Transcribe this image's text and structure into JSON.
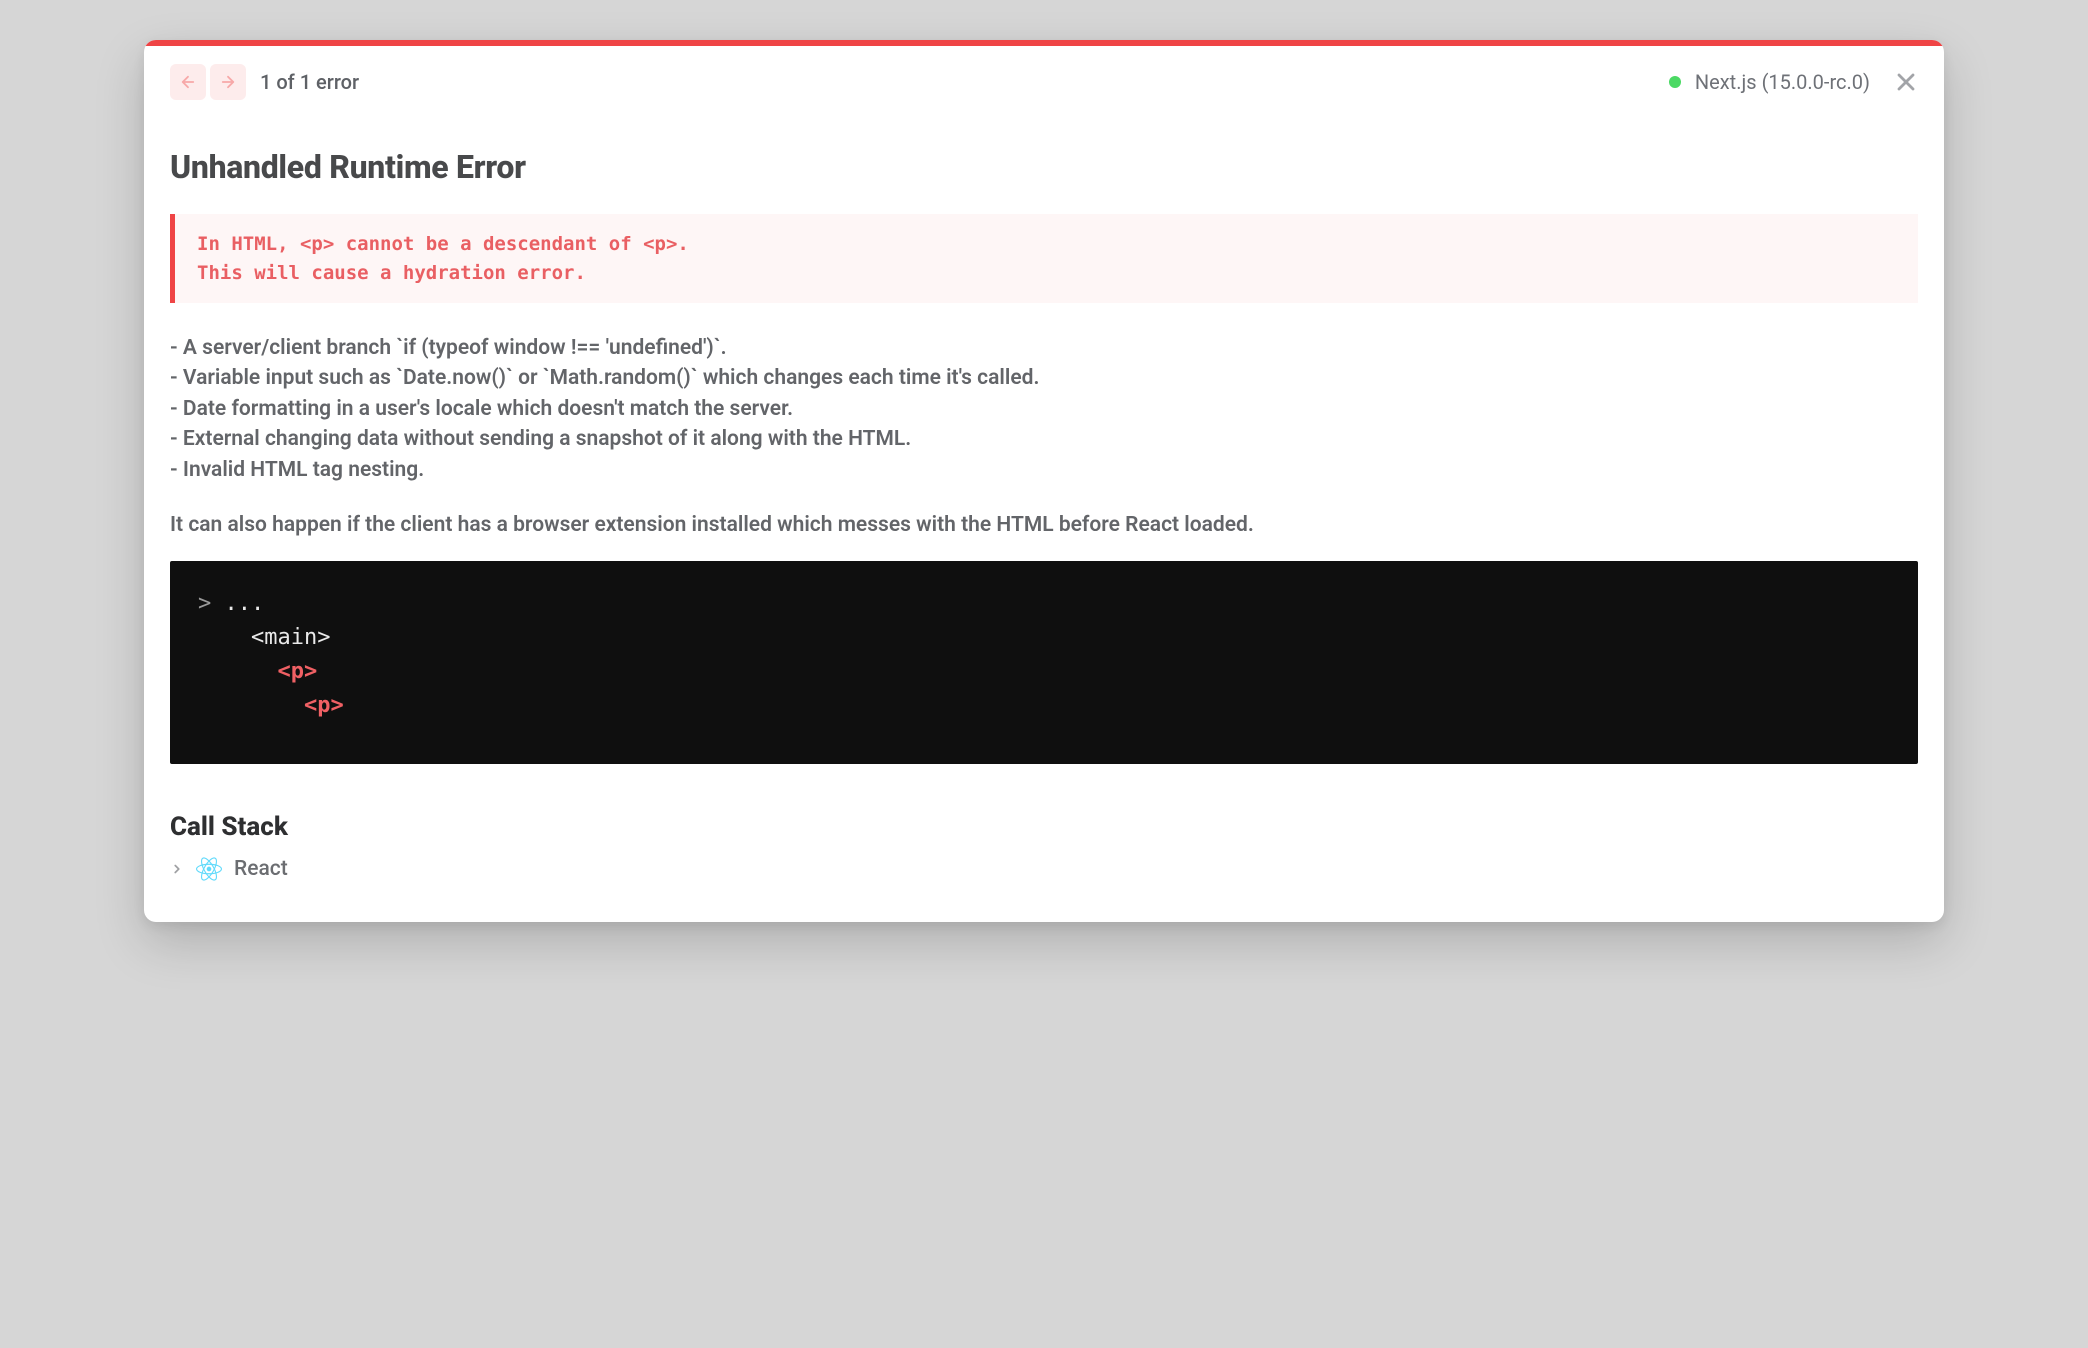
{
  "header": {
    "error_count_label": "1 of 1 error",
    "framework_label": "Next.js (15.0.0-rc.0)"
  },
  "title": "Unhandled Runtime Error",
  "error_message": "In HTML, <p> cannot be a descendant of <p>.\nThis will cause a hydration error.",
  "causes": [
    "- A server/client branch `if (typeof window !== 'undefined')`.",
    "- Variable input such as `Date.now()` or `Math.random()` which changes each time it's called.",
    "- Date formatting in a user's locale which doesn't match the server.",
    "- External changing data without sending a snapshot of it along with the HTML.",
    "- Invalid HTML tag nesting."
  ],
  "extra_note": "It can also happen if the client has a browser extension installed which messes with the HTML before React loaded.",
  "code": {
    "marker": "> ",
    "l0": "...",
    "l1": "<main>",
    "l2": "<p>",
    "l3": "<p>"
  },
  "stack": {
    "title": "Call Stack",
    "item": "React"
  },
  "colors": {
    "accent": "#ef4445",
    "status_ok": "#4bd964"
  }
}
